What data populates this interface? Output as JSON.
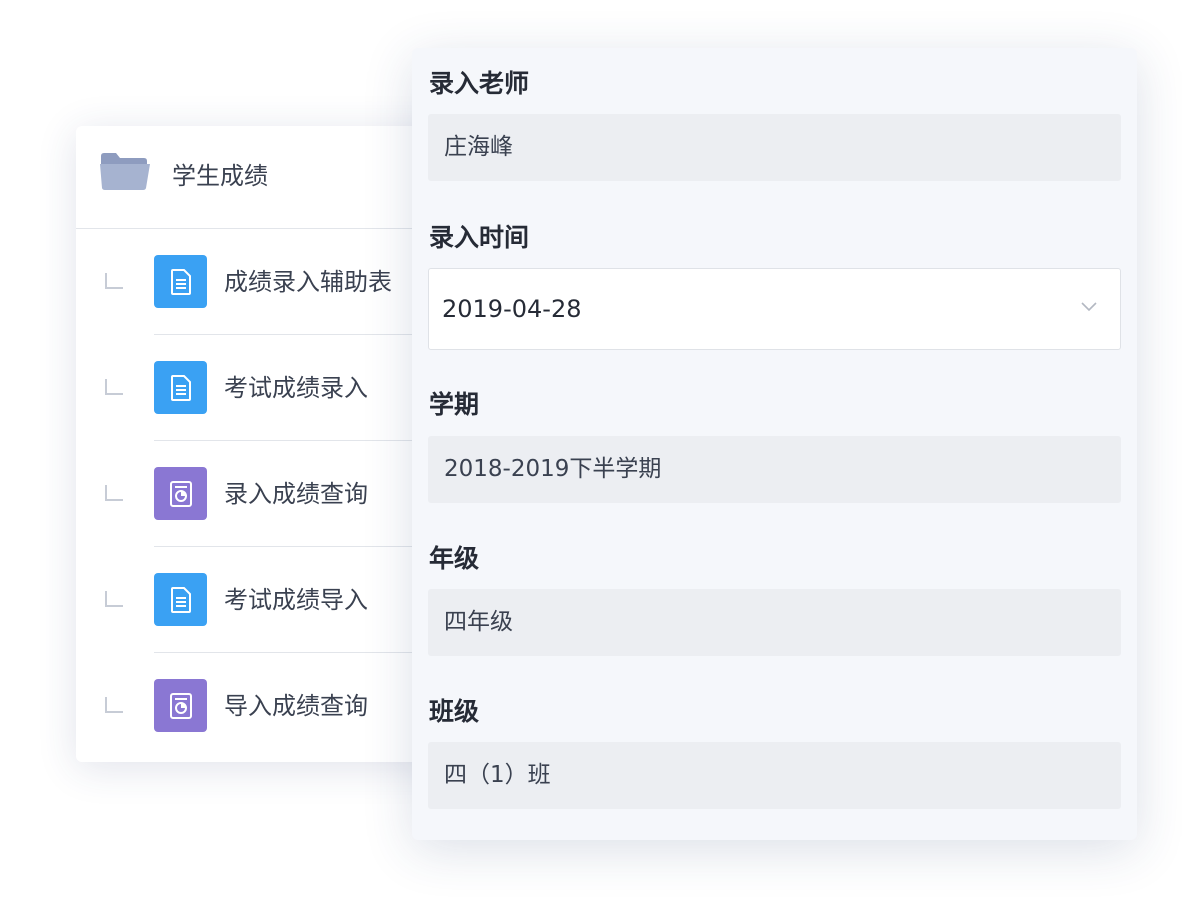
{
  "tree": {
    "folder_label": "学生成绩",
    "items": [
      {
        "label": "成绩录入辅助表",
        "icon": "document-icon",
        "color": "#3aa1f3"
      },
      {
        "label": "考试成绩录入",
        "icon": "document-icon",
        "color": "#3aa1f3"
      },
      {
        "label": "录入成绩查询",
        "icon": "report-icon",
        "color": "#8a77d3"
      },
      {
        "label": "考试成绩导入",
        "icon": "document-icon",
        "color": "#3aa1f3"
      },
      {
        "label": "导入成绩查询",
        "icon": "report-icon",
        "color": "#8a77d3"
      }
    ]
  },
  "form": {
    "teacher": {
      "label": "录入老师",
      "value": "庄海峰"
    },
    "entry_time": {
      "label": "录入时间",
      "value": "2019-04-28"
    },
    "semester": {
      "label": "学期",
      "value": "2018-2019下半学期"
    },
    "grade": {
      "label": "年级",
      "value": "四年级"
    },
    "class": {
      "label": "班级",
      "value": "四（1）班"
    }
  }
}
